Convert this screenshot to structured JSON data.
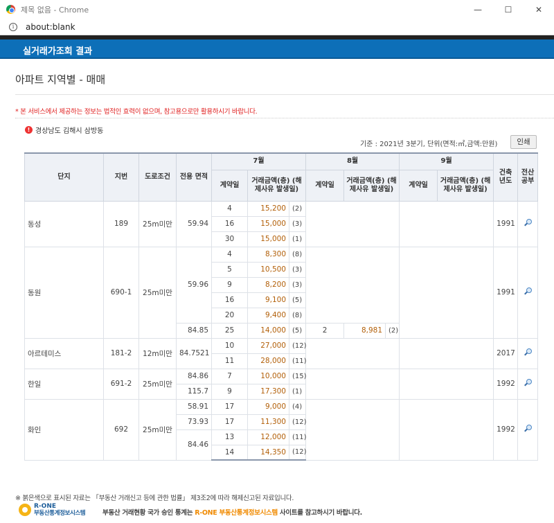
{
  "window": {
    "title": "제목 없음 - Chrome",
    "url": "about:blank",
    "minimize": "—",
    "maximize": "☐",
    "close": "✕"
  },
  "header": {
    "title": "실거래가조회 결과"
  },
  "page": {
    "heading": "아파트 지역별 - 매매",
    "notice": "* 본 서비스에서 제공하는 정보는 법적인 효력이 없으며, 참고용으로만 활용하시기 바랍니다.",
    "region": "경상남도 김해시 삼방동",
    "basis": "기준 : 2021년 3분기, 단위(면적:㎡,금액:만원)",
    "print_label": "인쇄"
  },
  "table": {
    "headers": {
      "complex": "단지",
      "lot": "지번",
      "road": "도로조건",
      "area": "전용 면적",
      "month1": "7월",
      "month2": "8월",
      "month3": "9월",
      "day": "계약일",
      "amount": "거래금액(층) (해제사유 발생일)",
      "year": "건축 년도",
      "registry": "전산 공부"
    },
    "rows": [
      {
        "complex": "동성",
        "lot": "189",
        "road": "25m미만",
        "area": "59.94",
        "year": "1991",
        "deals": [
          {
            "jul_day": "4",
            "jul_amt": "15,200",
            "jul_floor": "(2)"
          },
          {
            "jul_day": "16",
            "jul_amt": "15,000",
            "jul_floor": "(3)"
          },
          {
            "jul_day": "30",
            "jul_amt": "15,000",
            "jul_floor": "(1)"
          }
        ]
      },
      {
        "complex": "동원",
        "lot": "690-1",
        "road": "25m미만",
        "year": "1991",
        "areas": [
          {
            "area": "59.96",
            "deals": [
              {
                "jul_day": "4",
                "jul_amt": "8,300",
                "jul_floor": "(8)"
              },
              {
                "jul_day": "5",
                "jul_amt": "10,500",
                "jul_floor": "(3)"
              },
              {
                "jul_day": "9",
                "jul_amt": "8,200",
                "jul_floor": "(3)"
              },
              {
                "jul_day": "16",
                "jul_amt": "9,100",
                "jul_floor": "(5)"
              },
              {
                "jul_day": "20",
                "jul_amt": "9,400",
                "jul_floor": "(8)"
              }
            ]
          },
          {
            "area": "84.85",
            "deals": [
              {
                "jul_day": "25",
                "jul_amt": "14,000",
                "jul_floor": "(5)",
                "aug_day": "2",
                "aug_amt": "8,981",
                "aug_floor": "(2)"
              }
            ]
          }
        ]
      },
      {
        "complex": "아르테미스",
        "lot": "181-2",
        "road": "12m미만",
        "area": "84.7521",
        "year": "2017",
        "deals": [
          {
            "jul_day": "10",
            "jul_amt": "27,000",
            "jul_floor": "(12)"
          },
          {
            "jul_day": "11",
            "jul_amt": "28,000",
            "jul_floor": "(11)"
          }
        ]
      },
      {
        "complex": "한일",
        "lot": "691-2",
        "road": "25m미만",
        "year": "1992",
        "areas": [
          {
            "area": "84.86",
            "deals": [
              {
                "jul_day": "7",
                "jul_amt": "10,000",
                "jul_floor": "(15)"
              }
            ]
          },
          {
            "area": "115.7",
            "deals": [
              {
                "jul_day": "9",
                "jul_amt": "17,300",
                "jul_floor": "(1)"
              }
            ]
          }
        ]
      },
      {
        "complex": "화인",
        "lot": "692",
        "road": "25m미만",
        "year": "1992",
        "areas": [
          {
            "area": "58.91",
            "deals": [
              {
                "jul_day": "17",
                "jul_amt": "9,000",
                "jul_floor": "(4)"
              }
            ]
          },
          {
            "area": "73.93",
            "deals": [
              {
                "jul_day": "17",
                "jul_amt": "11,300",
                "jul_floor": "(12)"
              }
            ]
          },
          {
            "area": "84.46",
            "deals": [
              {
                "jul_day": "13",
                "jul_amt": "12,000",
                "jul_floor": "(11)"
              },
              {
                "jul_day": "14",
                "jul_amt": "14,350",
                "jul_floor": "(12)"
              }
            ]
          }
        ]
      }
    ]
  },
  "footer": {
    "note": "※ 붉은색으로 표시된 자료는 「부동산 거래신고 등에 관한 법률」 제3조2에 따라 해제신고된 자료입니다.",
    "logo_brand": "R-ONE",
    "logo_sub": "부동산통계정보시스템",
    "ad_pre": "부동산 거래현황 국가 승인 통계는 ",
    "ad_highlight": "R-ONE",
    "ad_system": " 부동산통계정보시스템",
    "ad_post": " 사이트를 참고하시기 바랍니다."
  }
}
